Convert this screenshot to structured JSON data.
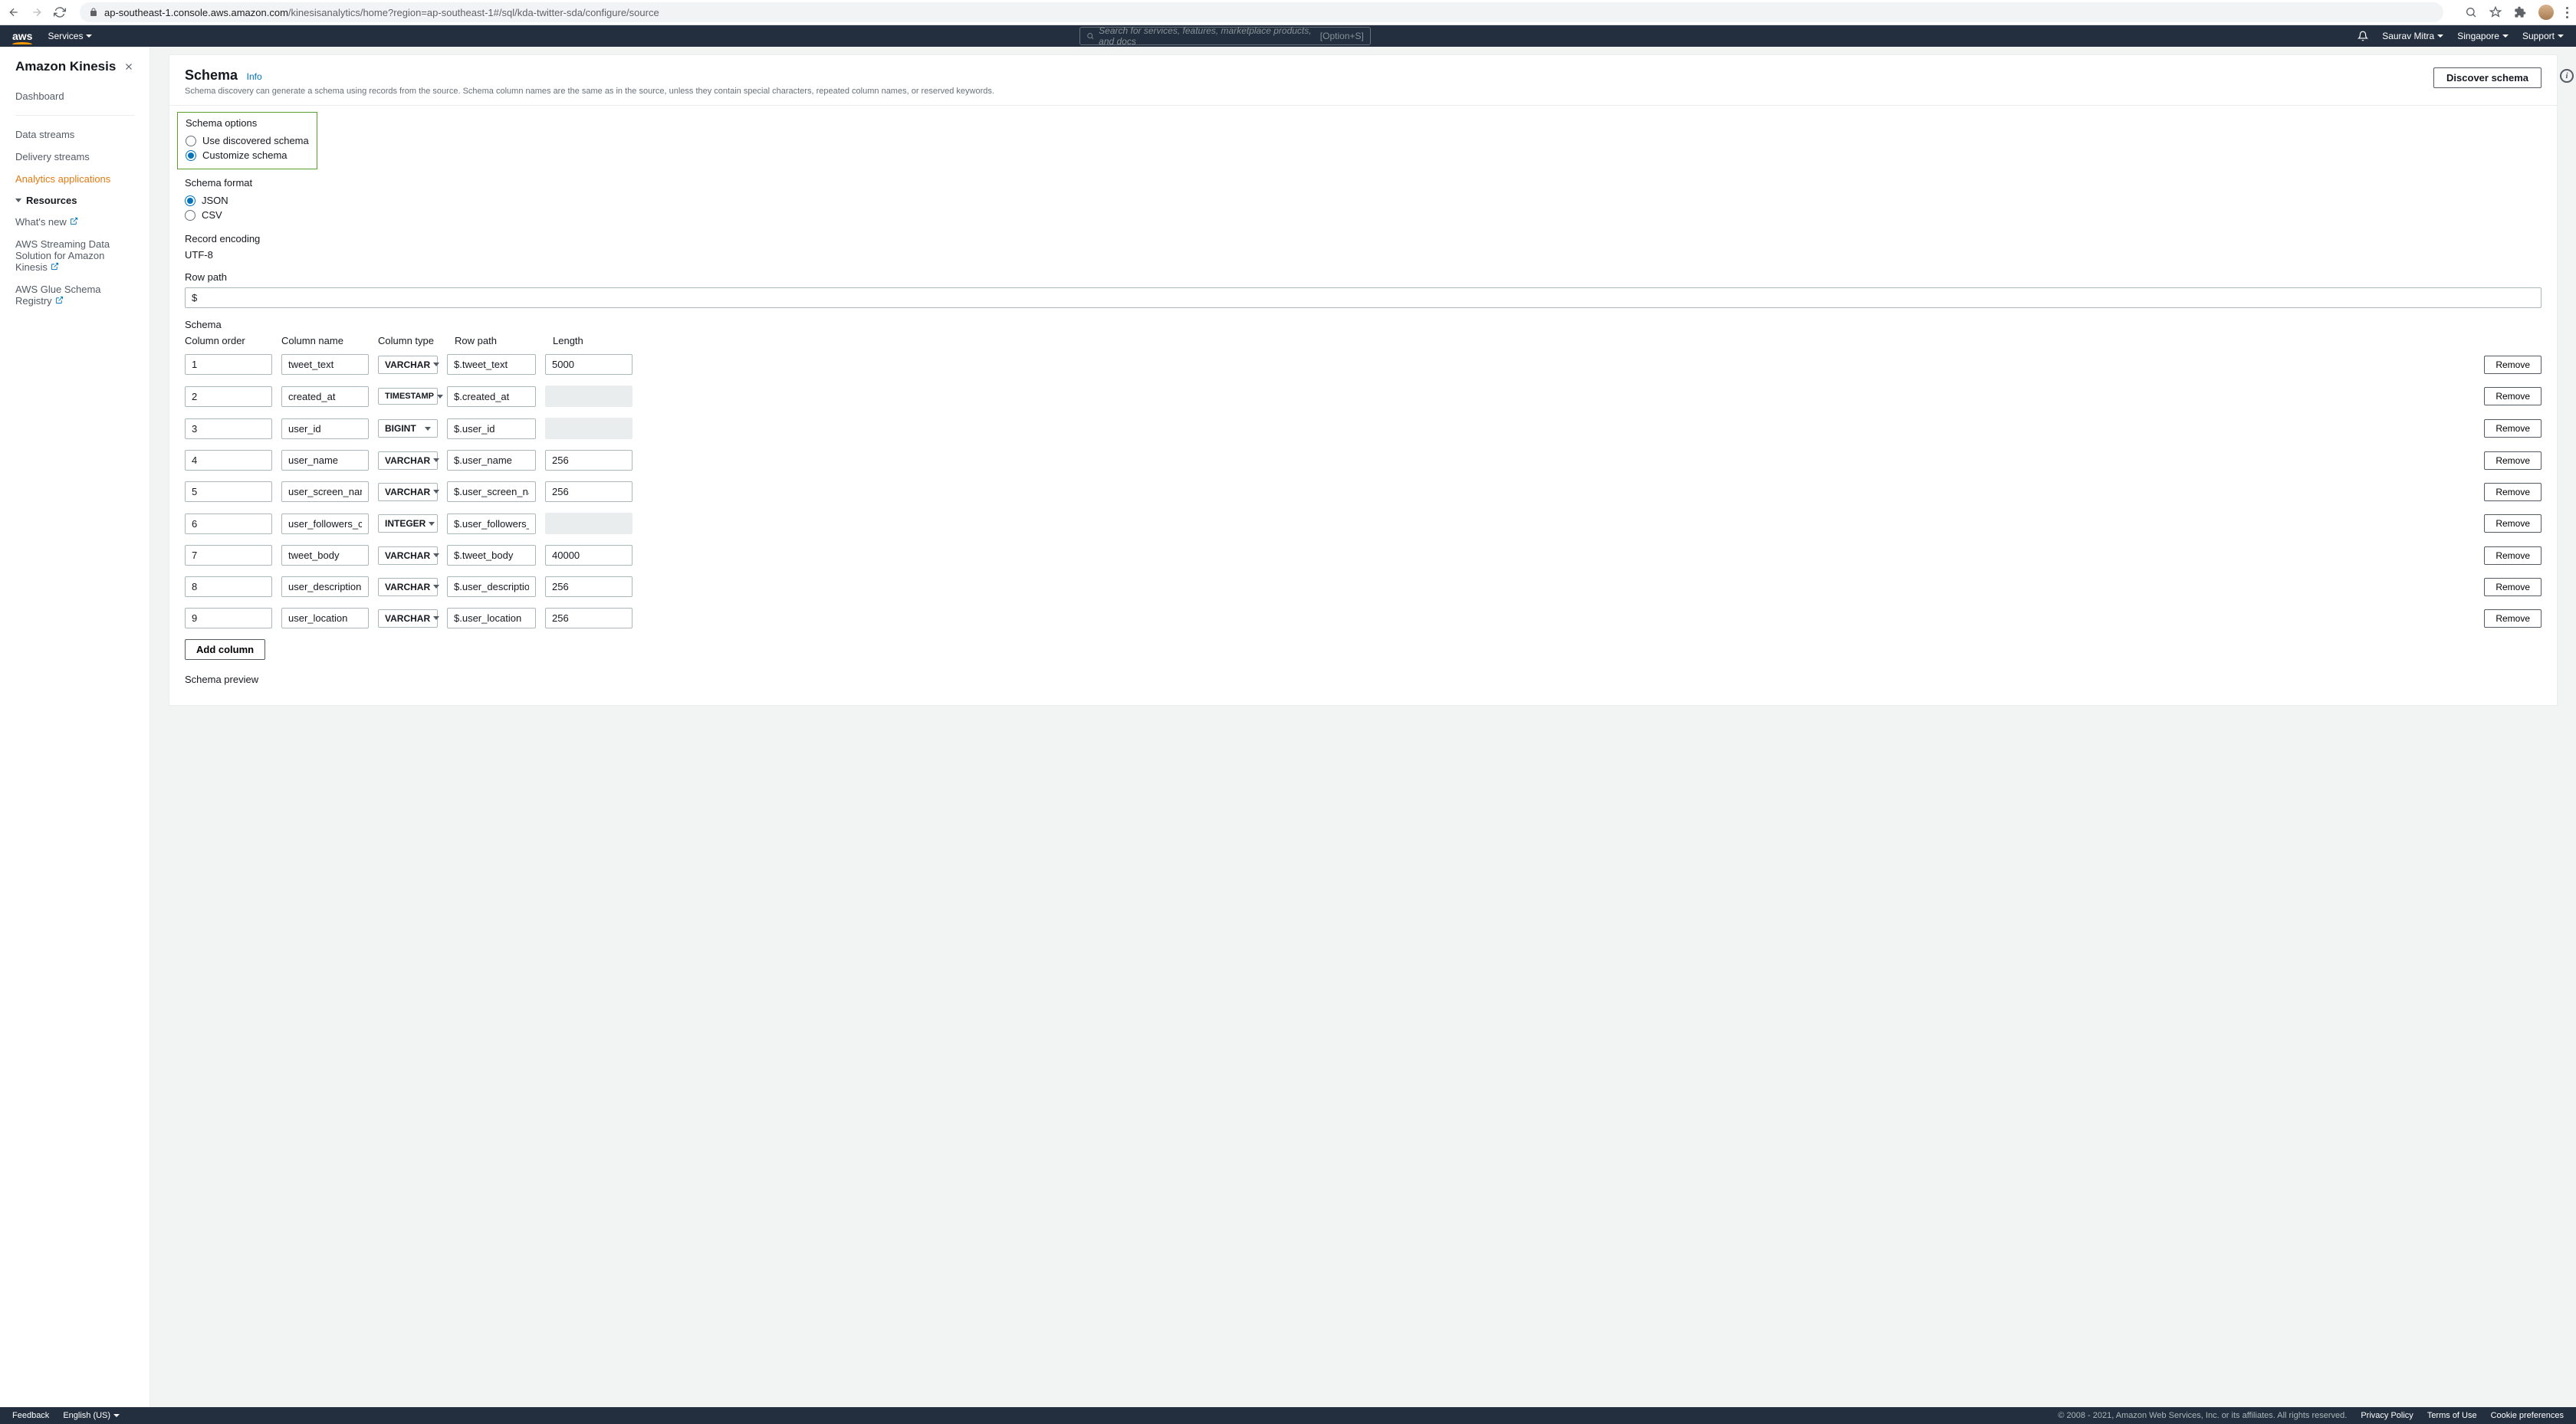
{
  "browser": {
    "url_host": "ap-southeast-1.console.aws.amazon.com",
    "url_path": "/kinesisanalytics/home?region=ap-southeast-1#/sql/kda-twitter-sda/configure/source"
  },
  "header": {
    "logo": "aws",
    "services": "Services",
    "search_placeholder": "Search for services, features, marketplace products, and docs",
    "search_hint": "[Option+S]",
    "user": "Saurav Mitra",
    "region": "Singapore",
    "support": "Support"
  },
  "sidebar": {
    "title": "Amazon Kinesis",
    "dashboard": "Dashboard",
    "data_streams": "Data streams",
    "delivery_streams": "Delivery streams",
    "analytics_apps": "Analytics applications",
    "resources": "Resources",
    "whats_new": "What's new",
    "streaming_solution": "AWS Streaming Data Solution for Amazon Kinesis",
    "glue_registry": "AWS Glue Schema Registry"
  },
  "panel": {
    "title": "Schema",
    "info": "Info",
    "desc": "Schema discovery can generate a schema using records from the source. Schema column names are the same as in the source, unless they contain special characters, repeated column names, or reserved keywords.",
    "discover_btn": "Discover schema"
  },
  "schema_options": {
    "label": "Schema options",
    "opt1": "Use discovered schema",
    "opt2": "Customize schema"
  },
  "schema_format": {
    "label": "Schema format",
    "json": "JSON",
    "csv": "CSV"
  },
  "record_encoding": {
    "label": "Record encoding",
    "value": "UTF-8"
  },
  "row_path": {
    "label": "Row path",
    "value": "$"
  },
  "schema": {
    "label": "Schema",
    "headers": {
      "order": "Column order",
      "name": "Column name",
      "type": "Column type",
      "path": "Row path",
      "length": "Length"
    },
    "rows": [
      {
        "order": "1",
        "name": "tweet_text",
        "type": "VARCHAR",
        "path": "$.tweet_text",
        "length": "5000",
        "len_enabled": true
      },
      {
        "order": "2",
        "name": "created_at",
        "type": "TIMESTAMP",
        "path": "$.created_at",
        "length": "",
        "len_enabled": false
      },
      {
        "order": "3",
        "name": "user_id",
        "type": "BIGINT",
        "path": "$.user_id",
        "length": "",
        "len_enabled": false
      },
      {
        "order": "4",
        "name": "user_name",
        "type": "VARCHAR",
        "path": "$.user_name",
        "length": "256",
        "len_enabled": true
      },
      {
        "order": "5",
        "name": "user_screen_name",
        "type": "VARCHAR",
        "path": "$.user_screen_name",
        "length": "256",
        "len_enabled": true
      },
      {
        "order": "6",
        "name": "user_followers_count",
        "type": "INTEGER",
        "path": "$.user_followers_coun",
        "length": "",
        "len_enabled": false
      },
      {
        "order": "7",
        "name": "tweet_body",
        "type": "VARCHAR",
        "path": "$.tweet_body",
        "length": "40000",
        "len_enabled": true
      },
      {
        "order": "8",
        "name": "user_description",
        "type": "VARCHAR",
        "path": "$.user_description",
        "length": "256",
        "len_enabled": true
      },
      {
        "order": "9",
        "name": "user_location",
        "type": "VARCHAR",
        "path": "$.user_location",
        "length": "256",
        "len_enabled": true
      }
    ],
    "remove": "Remove",
    "add_column": "Add column",
    "preview": "Schema preview"
  },
  "footer": {
    "feedback": "Feedback",
    "language": "English (US)",
    "copyright": "© 2008 - 2021, Amazon Web Services, Inc. or its affiliates. All rights reserved.",
    "privacy": "Privacy Policy",
    "terms": "Terms of Use",
    "cookies": "Cookie preferences"
  }
}
